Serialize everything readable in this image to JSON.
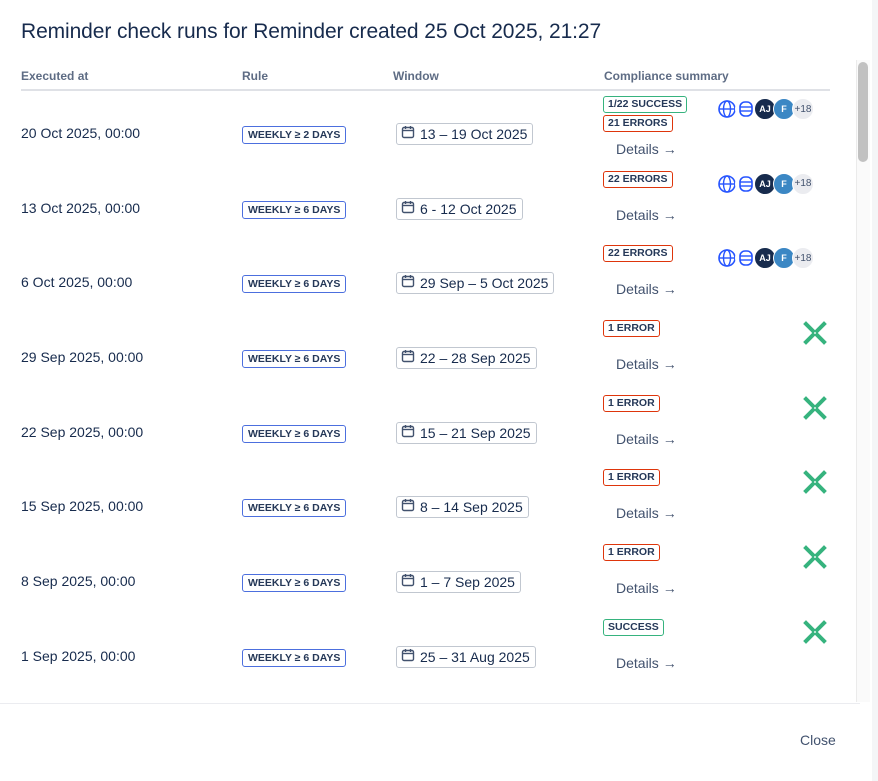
{
  "modal": {
    "title": "Reminder check runs for Reminder created 25 Oct 2025, 21:27",
    "close_label": "Close"
  },
  "columns": {
    "executed_at": "Executed at",
    "rule": "Rule",
    "window": "Window",
    "compliance": "Compliance summary"
  },
  "colors": {
    "success": "#36b37e",
    "error": "#de350b",
    "rule_border": "#4c6fde",
    "status_icon": "#36b37e"
  },
  "details_label": "Details",
  "details_arrow": "→",
  "rows": [
    {
      "executed": "20 Oct 2025, 00:00",
      "rule": "WEEKLY ≥ 2 DAYS",
      "window": "13 – 19 Oct 2025",
      "badges": [
        {
          "text": "1/22 SUCCESS",
          "kind": "success"
        },
        {
          "text": "21 ERRORS",
          "kind": "error"
        }
      ],
      "avatars": true,
      "avatar_initials": [
        "AJ",
        "F"
      ],
      "more": "+18"
    },
    {
      "executed": "13 Oct 2025, 00:00",
      "rule": "WEEKLY ≥ 6 DAYS",
      "window": "6 - 12 Oct 2025",
      "badges": [
        {
          "text": "22 ERRORS",
          "kind": "error"
        }
      ],
      "avatars": true,
      "avatar_initials": [
        "AJ",
        "F"
      ],
      "more": "+18"
    },
    {
      "executed": "6 Oct 2025, 00:00",
      "rule": "WEEKLY ≥ 6 DAYS",
      "window": "29 Sep – 5 Oct 2025",
      "badges": [
        {
          "text": "22 ERRORS",
          "kind": "error"
        }
      ],
      "avatars": true,
      "avatar_initials": [
        "AJ",
        "F"
      ],
      "more": "+18"
    },
    {
      "executed": "29 Sep 2025, 00:00",
      "rule": "WEEKLY ≥ 6 DAYS",
      "window": "22 – 28 Sep 2025",
      "badges": [
        {
          "text": "1 ERROR",
          "kind": "error"
        }
      ],
      "avatars": false
    },
    {
      "executed": "22 Sep 2025, 00:00",
      "rule": "WEEKLY ≥ 6 DAYS",
      "window": "15 – 21 Sep 2025",
      "badges": [
        {
          "text": "1 ERROR",
          "kind": "error"
        }
      ],
      "avatars": false
    },
    {
      "executed": "15 Sep 2025, 00:00",
      "rule": "WEEKLY ≥ 6 DAYS",
      "window": "8 – 14 Sep 2025",
      "badges": [
        {
          "text": "1 ERROR",
          "kind": "error"
        }
      ],
      "avatars": false
    },
    {
      "executed": "8 Sep 2025, 00:00",
      "rule": "WEEKLY ≥ 6 DAYS",
      "window": "1 – 7 Sep 2025",
      "badges": [
        {
          "text": "1 ERROR",
          "kind": "error"
        }
      ],
      "avatars": false
    },
    {
      "executed": "1 Sep 2025, 00:00",
      "rule": "WEEKLY ≥ 6 DAYS",
      "window": "25 – 31 Aug 2025",
      "badges": [
        {
          "text": "SUCCESS",
          "kind": "success"
        }
      ],
      "avatars": false
    }
  ]
}
